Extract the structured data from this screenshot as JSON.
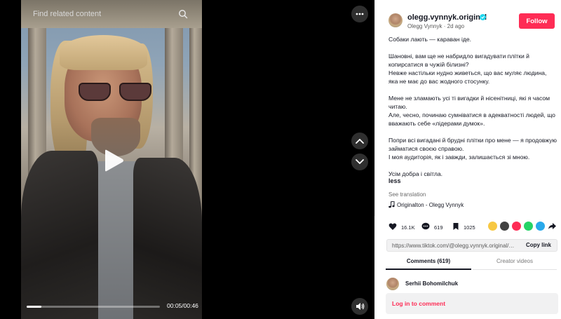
{
  "video": {
    "search_placeholder": "Find related content",
    "time": "00:05/00:46",
    "progress": 0.11
  },
  "author": {
    "handle": "olegg.vynnyk.original",
    "display_name": "Olegg Vynnyk",
    "posted": "2d ago",
    "follow_label": "Follow"
  },
  "caption": {
    "paragraphs": [
      "Собаки лають — караван іде.",
      "Шановні, вам ще не набридло вигадувати плітки й копирсатися в чужій білизні?\nНевже настільки нудно живеться, що вас муляє людина, яка не має до вас жодного стосунку.",
      "Мене не зламають усі ті вигадки й нісенітниці, які я часом читаю.\nАле, чесно, починаю сумніватися в адекватності людей, що вважають себе «лідерами думок».",
      "Попри всі вигадані й брудні плітки про мене — я продовжую займатися своєю справою.\nІ моя аудиторія, як і завжди, залишається зі мною.",
      "Усім добра і світла."
    ],
    "less_label": "less",
    "translation_label": "See translation",
    "music": "Originalton - Olegg Vynnyk"
  },
  "stats": {
    "likes": "16.1K",
    "comments": "619",
    "saves": "1025"
  },
  "share": {
    "url": "https://www.tiktok.com/@olegg.vynnyk.original/vid...",
    "copy_label": "Copy link"
  },
  "tabs": {
    "comments": "Comments (619)",
    "creator": "Creator videos"
  },
  "comments": {
    "first_author": "Serhii Bohomilchuk",
    "login_label": "Log in to comment"
  },
  "colors": {
    "accent": "#fe2c55",
    "verified": "#20d5ec"
  }
}
